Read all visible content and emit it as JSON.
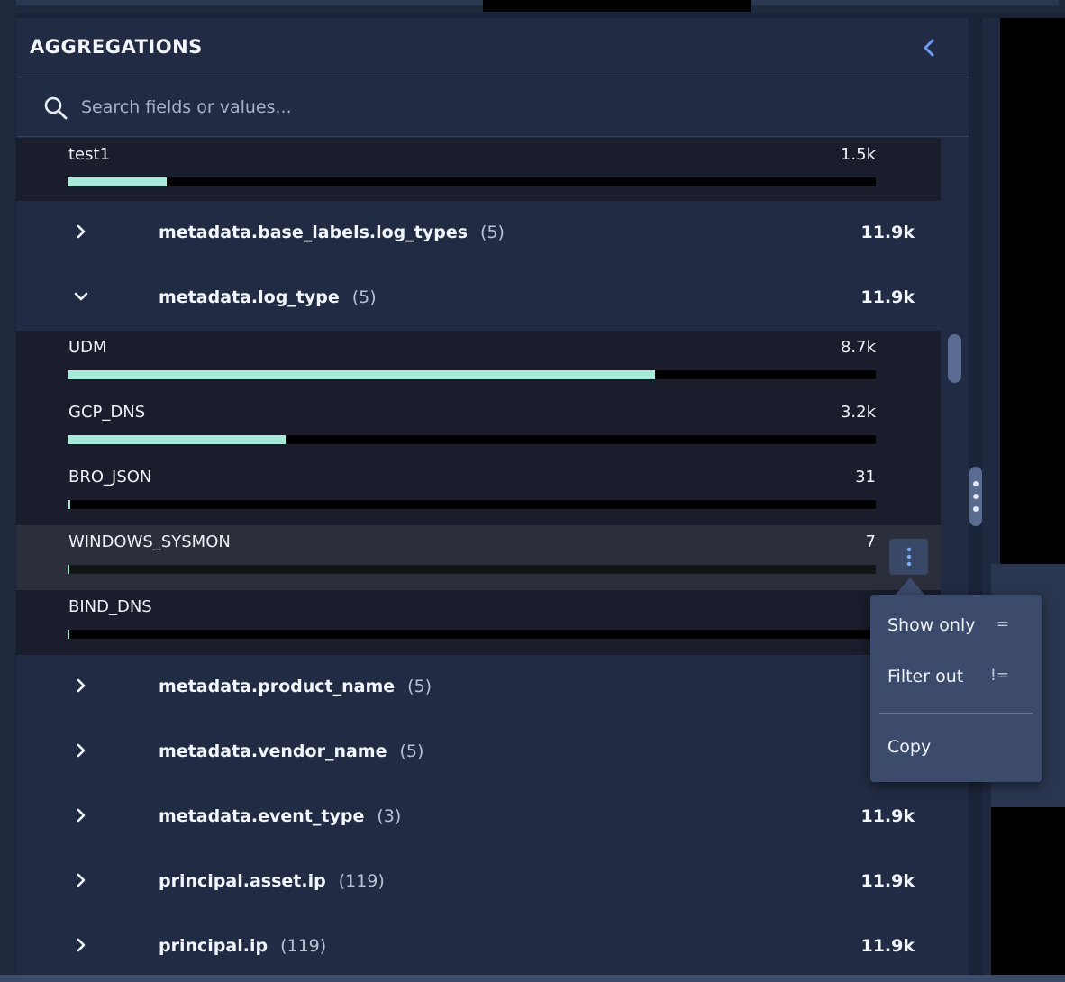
{
  "panel": {
    "title": "AGGREGATIONS",
    "search_placeholder": "Search fields or values..."
  },
  "top_value": {
    "name": "test1",
    "count": "1.5k",
    "fraction": 0.123
  },
  "fields": [
    {
      "name": "metadata.base_labels.log_types",
      "num": "(5)",
      "total": "11.9k",
      "expanded": false
    },
    {
      "name": "metadata.log_type",
      "num": "(5)",
      "total": "11.9k",
      "expanded": true
    },
    {
      "name": "metadata.product_name",
      "num": "(5)",
      "total": "",
      "expanded": false
    },
    {
      "name": "metadata.vendor_name",
      "num": "(5)",
      "total": "",
      "expanded": false
    },
    {
      "name": "metadata.event_type",
      "num": "(3)",
      "total": "11.9k",
      "expanded": false
    },
    {
      "name": "principal.asset.ip",
      "num": "(119)",
      "total": "11.9k",
      "expanded": false
    },
    {
      "name": "principal.ip",
      "num": "(119)",
      "total": "11.9k",
      "expanded": false
    }
  ],
  "log_type_values": [
    {
      "name": "UDM",
      "count": "8.7k",
      "fraction": 0.727
    },
    {
      "name": "GCP_DNS",
      "count": "3.2k",
      "fraction": 0.27
    },
    {
      "name": "BRO_JSON",
      "count": "31",
      "fraction": 0.003
    },
    {
      "name": "WINDOWS_SYSMON",
      "count": "7",
      "fraction": 0.001
    },
    {
      "name": "BIND_DNS",
      "count": "",
      "fraction": 0.0005
    }
  ],
  "context_menu": {
    "items": [
      {
        "label": "Show only",
        "op": "="
      },
      {
        "label": "Filter out",
        "op": "!="
      }
    ],
    "copy_label": "Copy"
  },
  "colors": {
    "bar_fill": "#a7ead9",
    "panel_bg": "#212c44",
    "value_row_bg": "#191d2c",
    "menu_bg": "#3c4b6b"
  }
}
